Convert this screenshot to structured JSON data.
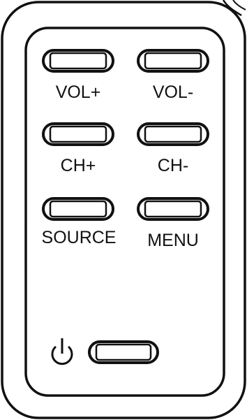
{
  "remote": {
    "buttons": {
      "vol_up": {
        "label": "VOL+"
      },
      "vol_down": {
        "label": "VOL-"
      },
      "ch_up": {
        "label": "CH+"
      },
      "ch_down": {
        "label": "CH-"
      },
      "source": {
        "label": "SOURCE"
      },
      "menu": {
        "label": "MENU"
      }
    },
    "power_icon": "power-icon",
    "colors": {
      "stroke": "#111111",
      "background": "#ffffff"
    }
  }
}
